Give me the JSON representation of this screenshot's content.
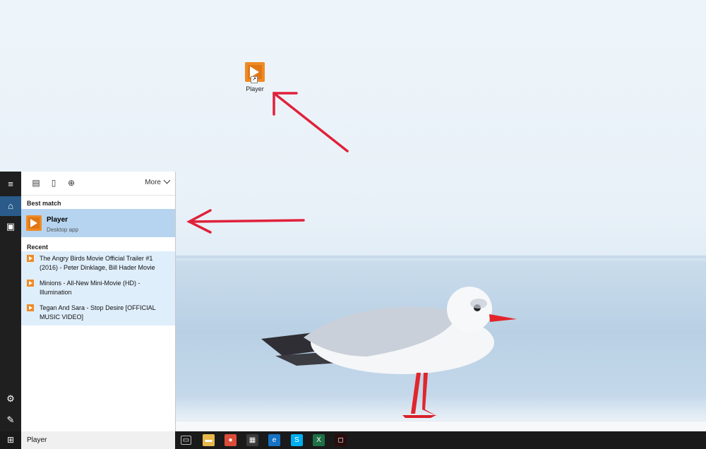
{
  "desktop": {
    "shortcut_label": "Player"
  },
  "rail": {
    "menu_icon": "≡",
    "home_icon": "⌂",
    "notebook_icon": "▣",
    "settings_icon": "⚙",
    "feedback_icon": "✎"
  },
  "panel": {
    "filters": {
      "apps_icon": "▤",
      "documents_icon": "▯",
      "web_icon": "⊕",
      "more_label": "More"
    },
    "best_match_heading": "Best match",
    "best_match": {
      "title": "Player",
      "subtitle": "Desktop app"
    },
    "recent_heading": "Recent",
    "recent": [
      {
        "line1": "The Angry Birds Movie Official Trailer #1",
        "line2": "(2016) - Peter Dinklage, Bill Hader Movie"
      },
      {
        "line1": "Minions - All-New Mini-Movie (HD) -",
        "line2": "Illumination"
      },
      {
        "line1": "Tegan And Sara - Stop Desire [OFFICIAL",
        "line2": "MUSIC VIDEO]"
      }
    ]
  },
  "taskbar": {
    "start_icon": "⊞",
    "search_value": "Player",
    "apps": [
      {
        "name": "task-view-icon",
        "glyph": "▭",
        "color": "#1a1a1a"
      },
      {
        "name": "file-explorer-icon",
        "glyph": "▬",
        "color": "#e8b84a"
      },
      {
        "name": "chrome-icon",
        "glyph": "●",
        "color": "#dd4b39"
      },
      {
        "name": "store-icon",
        "glyph": "▦",
        "color": "#3a3a3a"
      },
      {
        "name": "edge-icon",
        "glyph": "e",
        "color": "#1572c4"
      },
      {
        "name": "skype-icon",
        "glyph": "S",
        "color": "#00aff0"
      },
      {
        "name": "excel-icon",
        "glyph": "X",
        "color": "#1e7145"
      },
      {
        "name": "red-app-icon",
        "glyph": "◻",
        "color": "#2a0d0d"
      }
    ]
  }
}
